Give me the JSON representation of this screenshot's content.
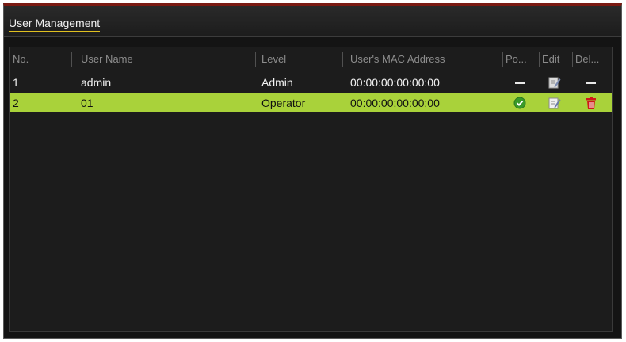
{
  "window": {
    "title_tab": "User Management"
  },
  "table": {
    "headers": {
      "no": "No.",
      "user_name": "User Name",
      "level": "Level",
      "mac": "User's MAC Address",
      "permission": "Po...",
      "edit": "Edit",
      "delete": "Del..."
    },
    "rows": [
      {
        "no": "1",
        "user_name": "admin",
        "level": "Admin",
        "mac": "00:00:00:00:00:00",
        "permission_icon": "dash-icon",
        "edit_icon": "edit-icon",
        "delete_icon": "dash-icon"
      },
      {
        "no": "2",
        "user_name": "01",
        "level": "Operator",
        "mac": "00:00:00:00:00:00",
        "permission_icon": "check-circle-icon",
        "edit_icon": "edit-icon",
        "delete_icon": "trash-icon",
        "selected": true
      }
    ]
  },
  "colors": {
    "selected_row": "#a9d23a",
    "tab_underline": "#e0c020",
    "delete_icon": "#d01818",
    "check_icon": "#3a9a2a"
  }
}
